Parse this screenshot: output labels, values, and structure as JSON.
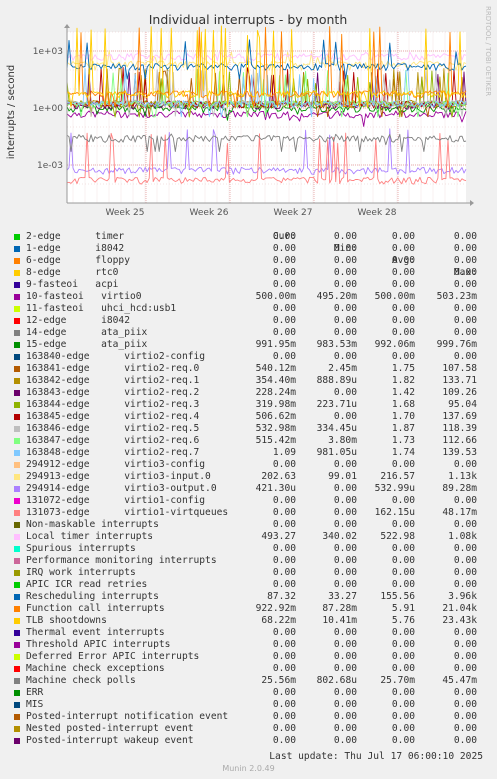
{
  "chart_data": {
    "type": "line",
    "title": "Individual interrupts - by month",
    "ylabel": "interrupts / second",
    "xlabel": "",
    "yscale": "log",
    "ylim": [
      1e-05,
      10000
    ],
    "y_ticks": [
      "1e+03",
      "1e+00",
      "1e-03"
    ],
    "x_ticks": [
      "Week 25",
      "Week 26",
      "Week 27",
      "Week 28"
    ],
    "grid": true,
    "side_label": "RRDTOOL / TOBI OETIKER",
    "legend_headers": {
      "cur": "Cur:",
      "min": "Min:",
      "avg": "Avg:",
      "max": "Max:"
    },
    "series": [
      {
        "name": "2-edge      timer",
        "color": "#00cc00",
        "cur": "0.00",
        "min": "0.00",
        "avg": "0.00",
        "max": "0.00"
      },
      {
        "name": "1-edge      i8042",
        "color": "#0066b3",
        "cur": "0.00",
        "min": "0.00",
        "avg": "0.00",
        "max": "0.00"
      },
      {
        "name": "6-edge      floppy",
        "color": "#ff8000",
        "cur": "0.00",
        "min": "0.00",
        "avg": "0.00",
        "max": "0.00"
      },
      {
        "name": "8-edge      rtc0",
        "color": "#ffcc00",
        "cur": "0.00",
        "min": "0.00",
        "avg": "0.00",
        "max": "0.00"
      },
      {
        "name": "9-fasteoi   acpi",
        "color": "#330099",
        "cur": "0.00",
        "min": "0.00",
        "avg": "0.00",
        "max": "0.00"
      },
      {
        "name": "10-fasteoi   virtio0",
        "color": "#990099",
        "cur": "500.00m",
        "min": "495.20m",
        "avg": "500.00m",
        "max": "503.23m"
      },
      {
        "name": "11-fasteoi   uhci_hcd:usb1",
        "color": "#ccff00",
        "cur": "0.00",
        "min": "0.00",
        "avg": "0.00",
        "max": "0.00"
      },
      {
        "name": "12-edge      i8042",
        "color": "#ff0000",
        "cur": "0.00",
        "min": "0.00",
        "avg": "0.00",
        "max": "0.00"
      },
      {
        "name": "14-edge      ata_piix",
        "color": "#808080",
        "cur": "0.00",
        "min": "0.00",
        "avg": "0.00",
        "max": "0.00"
      },
      {
        "name": "15-edge      ata_piix",
        "color": "#008f00",
        "cur": "991.95m",
        "min": "983.53m",
        "avg": "992.06m",
        "max": "999.76m"
      },
      {
        "name": "163840-edge      virtio2-config",
        "color": "#00487d",
        "cur": "0.00",
        "min": "0.00",
        "avg": "0.00",
        "max": "0.00"
      },
      {
        "name": "163841-edge      virtio2-req.0",
        "color": "#b35a00",
        "cur": "540.12m",
        "min": "2.45m",
        "avg": "1.75",
        "max": "107.58"
      },
      {
        "name": "163842-edge      virtio2-req.1",
        "color": "#b38f00",
        "cur": "354.40m",
        "min": "888.89u",
        "avg": "1.82",
        "max": "133.71"
      },
      {
        "name": "163843-edge      virtio2-req.2",
        "color": "#6b006b",
        "cur": "228.24m",
        "min": "0.00",
        "avg": "1.42",
        "max": "109.26"
      },
      {
        "name": "163844-edge      virtio2-req.3",
        "color": "#8fb300",
        "cur": "319.98m",
        "min": "223.71u",
        "avg": "1.68",
        "max": "95.04"
      },
      {
        "name": "163845-edge      virtio2-req.4",
        "color": "#b30000",
        "cur": "506.62m",
        "min": "0.00",
        "avg": "1.70",
        "max": "137.69"
      },
      {
        "name": "163846-edge      virtio2-req.5",
        "color": "#bebebe",
        "cur": "532.98m",
        "min": "334.45u",
        "avg": "1.87",
        "max": "118.39"
      },
      {
        "name": "163847-edge      virtio2-req.6",
        "color": "#80ff80",
        "cur": "515.42m",
        "min": "3.80m",
        "avg": "1.73",
        "max": "112.66"
      },
      {
        "name": "163848-edge      virtio2-req.7",
        "color": "#80c9ff",
        "cur": "1.09",
        "min": "981.05u",
        "avg": "1.74",
        "max": "139.53"
      },
      {
        "name": "294912-edge      virtio3-config",
        "color": "#ffc080",
        "cur": "0.00",
        "min": "0.00",
        "avg": "0.00",
        "max": "0.00"
      },
      {
        "name": "294913-edge      virtio3-input.0",
        "color": "#ffe680",
        "cur": "202.63",
        "min": "99.01",
        "avg": "216.57",
        "max": "1.13k"
      },
      {
        "name": "294914-edge      virtio3-output.0",
        "color": "#aa80ff",
        "cur": "421.30u",
        "min": "0.00",
        "avg": "532.99u",
        "max": "89.28m"
      },
      {
        "name": "131072-edge      virtio1-config",
        "color": "#ee00cc",
        "cur": "0.00",
        "min": "0.00",
        "avg": "0.00",
        "max": "0.00"
      },
      {
        "name": "131073-edge      virtio1-virtqueues",
        "color": "#ff8080",
        "cur": "0.00",
        "min": "0.00",
        "avg": "162.15u",
        "max": "48.17m"
      },
      {
        "name": "Non-maskable interrupts",
        "color": "#666600",
        "cur": "0.00",
        "min": "0.00",
        "avg": "0.00",
        "max": "0.00"
      },
      {
        "name": "Local timer interrupts",
        "color": "#ffbfff",
        "cur": "493.27",
        "min": "340.02",
        "avg": "522.98",
        "max": "1.08k"
      },
      {
        "name": "Spurious interrupts",
        "color": "#00ffcc",
        "cur": "0.00",
        "min": "0.00",
        "avg": "0.00",
        "max": "0.00"
      },
      {
        "name": "Performance monitoring interrupts",
        "color": "#cc6699",
        "cur": "0.00",
        "min": "0.00",
        "avg": "0.00",
        "max": "0.00"
      },
      {
        "name": "IRQ work interrupts",
        "color": "#999900",
        "cur": "0.00",
        "min": "0.00",
        "avg": "0.00",
        "max": "0.00"
      },
      {
        "name": "APIC ICR read retries",
        "color": "#00cc00",
        "cur": "0.00",
        "min": "0.00",
        "avg": "0.00",
        "max": "0.00"
      },
      {
        "name": "Rescheduling interrupts",
        "color": "#0066b3",
        "cur": "87.32",
        "min": "33.27",
        "avg": "155.56",
        "max": "3.96k"
      },
      {
        "name": "Function call interrupts",
        "color": "#ff8000",
        "cur": "922.92m",
        "min": "87.28m",
        "avg": "5.91",
        "max": "21.04k"
      },
      {
        "name": "TLB shootdowns",
        "color": "#ffcc00",
        "cur": "68.22m",
        "min": "10.41m",
        "avg": "5.76",
        "max": "23.43k"
      },
      {
        "name": "Thermal event interrupts",
        "color": "#330099",
        "cur": "0.00",
        "min": "0.00",
        "avg": "0.00",
        "max": "0.00"
      },
      {
        "name": "Threshold APIC interrupts",
        "color": "#990099",
        "cur": "0.00",
        "min": "0.00",
        "avg": "0.00",
        "max": "0.00"
      },
      {
        "name": "Deferred Error APIC interrupts",
        "color": "#ccff00",
        "cur": "0.00",
        "min": "0.00",
        "avg": "0.00",
        "max": "0.00"
      },
      {
        "name": "Machine check exceptions",
        "color": "#ff0000",
        "cur": "0.00",
        "min": "0.00",
        "avg": "0.00",
        "max": "0.00"
      },
      {
        "name": "Machine check polls",
        "color": "#808080",
        "cur": "25.56m",
        "min": "802.68u",
        "avg": "25.70m",
        "max": "45.47m"
      },
      {
        "name": "ERR",
        "color": "#008f00",
        "cur": "0.00",
        "min": "0.00",
        "avg": "0.00",
        "max": "0.00"
      },
      {
        "name": "MIS",
        "color": "#00487d",
        "cur": "0.00",
        "min": "0.00",
        "avg": "0.00",
        "max": "0.00"
      },
      {
        "name": "Posted-interrupt notification event",
        "color": "#b35a00",
        "cur": "0.00",
        "min": "0.00",
        "avg": "0.00",
        "max": "0.00"
      },
      {
        "name": "Nested posted-interrupt event",
        "color": "#b38f00",
        "cur": "0.00",
        "min": "0.00",
        "avg": "0.00",
        "max": "0.00"
      },
      {
        "name": "Posted-interrupt wakeup event",
        "color": "#6b006b",
        "cur": "0.00",
        "min": "0.00",
        "avg": "0.00",
        "max": "0.00"
      }
    ]
  },
  "footer": {
    "last_update": "Last update: Thu Jul 17 06:00:10 2025",
    "munin": "Munin 2.0.49"
  }
}
